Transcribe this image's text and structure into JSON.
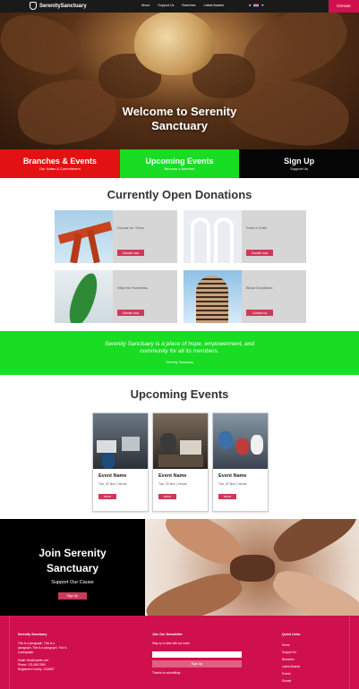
{
  "brand": "SerenitySanctuary",
  "colors": {
    "accent": "#d0104c",
    "red": "#e31212",
    "green": "#18dd22",
    "black": "#050505",
    "button": "#cc3a5a"
  },
  "nav": {
    "links": [
      "About",
      "Support Us",
      "Branches",
      "Latest Awards"
    ],
    "donate": "Donate"
  },
  "hero": {
    "title_line1": "Welcome to Serenity",
    "title_line2": "Sanctuary"
  },
  "bar": [
    {
      "title": "Branches & Events",
      "sub": "Our Notes & Commitment"
    },
    {
      "title": "Upcoming Events",
      "sub": "Become a Member"
    },
    {
      "title": "Sign Up",
      "sub": "Support Us"
    }
  ],
  "donations": {
    "title": "Currently Open Donations",
    "cards": [
      {
        "label": "Donate for Trees",
        "button": "Donate now"
      },
      {
        "label": "Feed a Child",
        "button": "Donate now"
      },
      {
        "label": "Help the Homeless",
        "button": "Donate now"
      },
      {
        "label": "Blood Donations",
        "button": "Contact us"
      }
    ]
  },
  "mission": {
    "line1": "Serenity Sanctuary is a place of hope, empowerment, and",
    "line2": "community for all its members.",
    "author": "Serenity Sanctuary"
  },
  "events": {
    "title": "Upcoming Events",
    "cards": [
      {
        "name": "Event Name",
        "meta": "Tue, 20 Nov  |  Venue",
        "button": "RSVP"
      },
      {
        "name": "Event Name",
        "meta": "Tue, 20 Nov  |  Venue",
        "button": "RSVP"
      },
      {
        "name": "Event Name",
        "meta": "Tue, 20 Nov  |  Venue",
        "button": "RSVP"
      }
    ]
  },
  "join": {
    "title_line1": "Join Serenity",
    "title_line2": "Sanctuary",
    "sub": "Support Our Cause",
    "button": "Sign Up"
  },
  "footer": {
    "about": {
      "head": "Serenity Sanctuary",
      "text1": "This is a paragraph. This is a",
      "text2": "paragraph. This is a paragraph. This is",
      "text3": "a paragraph.",
      "contact1": "Email: info@mysite.com",
      "contact2": "Phone: 123-456-7890",
      "contact3": "Registered Charity: 1234567"
    },
    "news": {
      "head": "Join Our Newsletter",
      "sub": "Stay up to date with our news",
      "button": "Sign Up",
      "note": "Thanks for submitting!"
    },
    "links": {
      "head": "Quick Links",
      "items": [
        "Home",
        "Support Us",
        "Branches",
        "Latest Awards",
        "Events",
        "Donate"
      ]
    }
  }
}
